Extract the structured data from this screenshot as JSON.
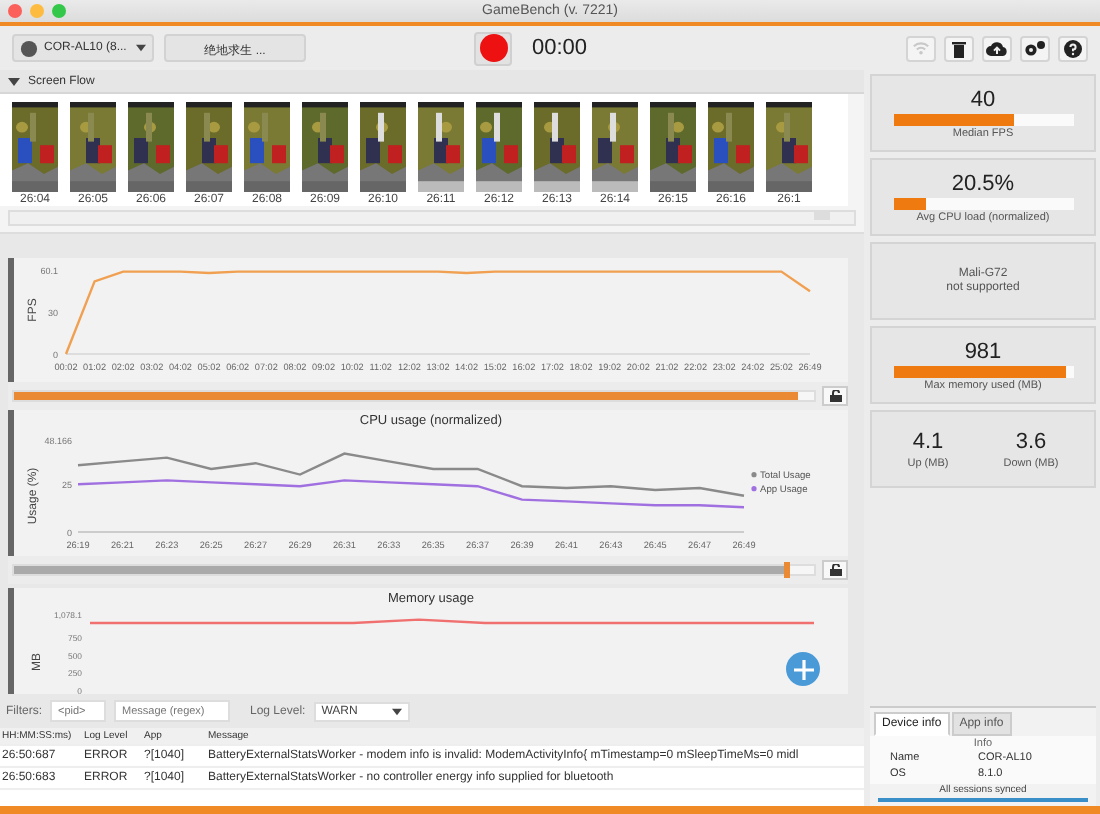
{
  "window": {
    "title": "GameBench (v. 7221)"
  },
  "toolbar": {
    "device": "COR-AL10 (8...",
    "app": "绝地求生 ...",
    "timer": "00:00",
    "buttons": [
      {
        "kind": "wifi",
        "disabled": true
      },
      {
        "kind": "trash",
        "disabled": false
      },
      {
        "kind": "cloud",
        "disabled": false
      },
      {
        "kind": "settings",
        "disabled": false
      },
      {
        "kind": "help",
        "disabled": false
      }
    ]
  },
  "screen_flow": {
    "title": "Screen Flow",
    "expanded": true,
    "frames": [
      {
        "time": "26:04"
      },
      {
        "time": "26:05"
      },
      {
        "time": "26:06"
      },
      {
        "time": "26:07"
      },
      {
        "time": "26:08"
      },
      {
        "time": "26:09"
      },
      {
        "time": "26:10"
      },
      {
        "time": "26:11"
      },
      {
        "time": "26:12"
      },
      {
        "time": "26:13"
      },
      {
        "time": "26:14"
      },
      {
        "time": "26:15"
      },
      {
        "time": "26:16"
      },
      {
        "time": "26:1"
      }
    ]
  },
  "fps_panel": {
    "slider": {
      "level": 0.98
    },
    "chart_data": {
      "type": "line",
      "ylabel": "FPS",
      "categories": [
        "00:02",
        "01:02",
        "02:02",
        "03:02",
        "04:02",
        "05:02",
        "06:02",
        "07:02",
        "08:02",
        "09:02",
        "10:02",
        "11:02",
        "12:02",
        "13:02",
        "14:02",
        "15:02",
        "16:02",
        "17:02",
        "18:02",
        "19:02",
        "20:02",
        "21:02",
        "22:02",
        "23:02",
        "24:02",
        "25:02",
        "26:49"
      ],
      "series": [
        {
          "color": "#f0a050",
          "values": [
            0,
            52,
            59,
            59,
            59,
            58,
            59,
            59,
            59,
            59,
            59,
            59,
            59,
            59,
            58,
            59,
            59,
            59,
            59,
            59,
            59,
            59,
            59,
            59,
            59,
            59,
            45
          ]
        }
      ],
      "ylim": [
        0,
        60.1
      ],
      "yticks": [
        0,
        30,
        {
          "value": 60.1,
          "label": "60.1"
        }
      ]
    }
  },
  "cpu_panel": {
    "title": "CPU usage (normalized)",
    "slider": {
      "level": 0.97
    },
    "chart_data": {
      "type": "line",
      "ylabel": "Usage (%)",
      "categories": [
        "26:19",
        "26:21",
        "26:23",
        "26:25",
        "26:27",
        "26:29",
        "26:31",
        "26:33",
        "26:35",
        "26:37",
        "26:39",
        "26:41",
        "26:43",
        "26:45",
        "26:47",
        "26:49"
      ],
      "series": [
        {
          "name": "Total Usage",
          "color": "#8a8a8a",
          "values": [
            35,
            37,
            39,
            33,
            36,
            30,
            41,
            37,
            33,
            33,
            24,
            23,
            24,
            22,
            23,
            19
          ]
        },
        {
          "name": "App Usage",
          "color": "#a070e0",
          "values": [
            25,
            26,
            27,
            26,
            25,
            24,
            27,
            26,
            25,
            24,
            17,
            16,
            15,
            14,
            14,
            13
          ]
        }
      ],
      "ylim": [
        0,
        48.166
      ],
      "yticks": [
        0,
        25,
        {
          "value": 48.166,
          "label": "48.166"
        }
      ]
    }
  },
  "memory_panel": {
    "title": "Memory usage",
    "chart_data": {
      "type": "line",
      "ylabel": "MB",
      "series": [
        {
          "color": "#f07070",
          "values": [
            950,
            950,
            950,
            950,
            950,
            1000,
            950,
            950,
            950,
            950,
            950,
            950
          ]
        }
      ],
      "ylim": [
        0,
        1078.1
      ],
      "yticks": [
        0,
        250,
        500,
        750,
        {
          "value": 1078.1,
          "label": "1,078.1"
        }
      ]
    }
  },
  "log": {
    "filters_label": "Filters:",
    "pid_placeholder": "<pid>",
    "message_placeholder": "Message (regex)",
    "level_label": "Log Level:",
    "level": "WARN",
    "columns": [
      "HH:MM:SS:ms)",
      "Log Level",
      "App",
      "Message"
    ],
    "rows": [
      [
        "26:50:687",
        "ERROR",
        "?[1040]",
        "BatteryExternalStatsWorker - modem info is invalid: ModemActivityInfo{ mTimestamp=0 mSleepTimeMs=0 midl"
      ],
      [
        "26:50:683",
        "ERROR",
        "?[1040]",
        "BatteryExternalStatsWorker - no controller energy info supplied for bluetooth"
      ]
    ]
  },
  "stats": [
    {
      "kind": "meter",
      "value": "40",
      "level": 0.67,
      "label": "Median FPS"
    },
    {
      "kind": "meter",
      "value": "20.5%",
      "level": 0.18,
      "label": "Avg CPU load (normalized)"
    },
    {
      "kind": "note",
      "lines": [
        "Mali-G72",
        "not supported"
      ]
    },
    {
      "kind": "meter",
      "value": "981",
      "level": 0.96,
      "label": "Max memory used (MB)"
    },
    {
      "kind": "pair",
      "items": [
        {
          "value": "4.1",
          "label": "Up (MB)"
        },
        {
          "value": "3.6",
          "label": "Down (MB)"
        }
      ]
    }
  ],
  "info_tabs": [
    {
      "label": "Device info",
      "selected": true
    },
    {
      "label": "App info",
      "selected": false
    }
  ],
  "info_table": {
    "header": "Info",
    "rows": [
      [
        "Name",
        "COR-AL10"
      ],
      [
        "OS",
        "8.1.0"
      ]
    ]
  },
  "status": "All sessions synced"
}
